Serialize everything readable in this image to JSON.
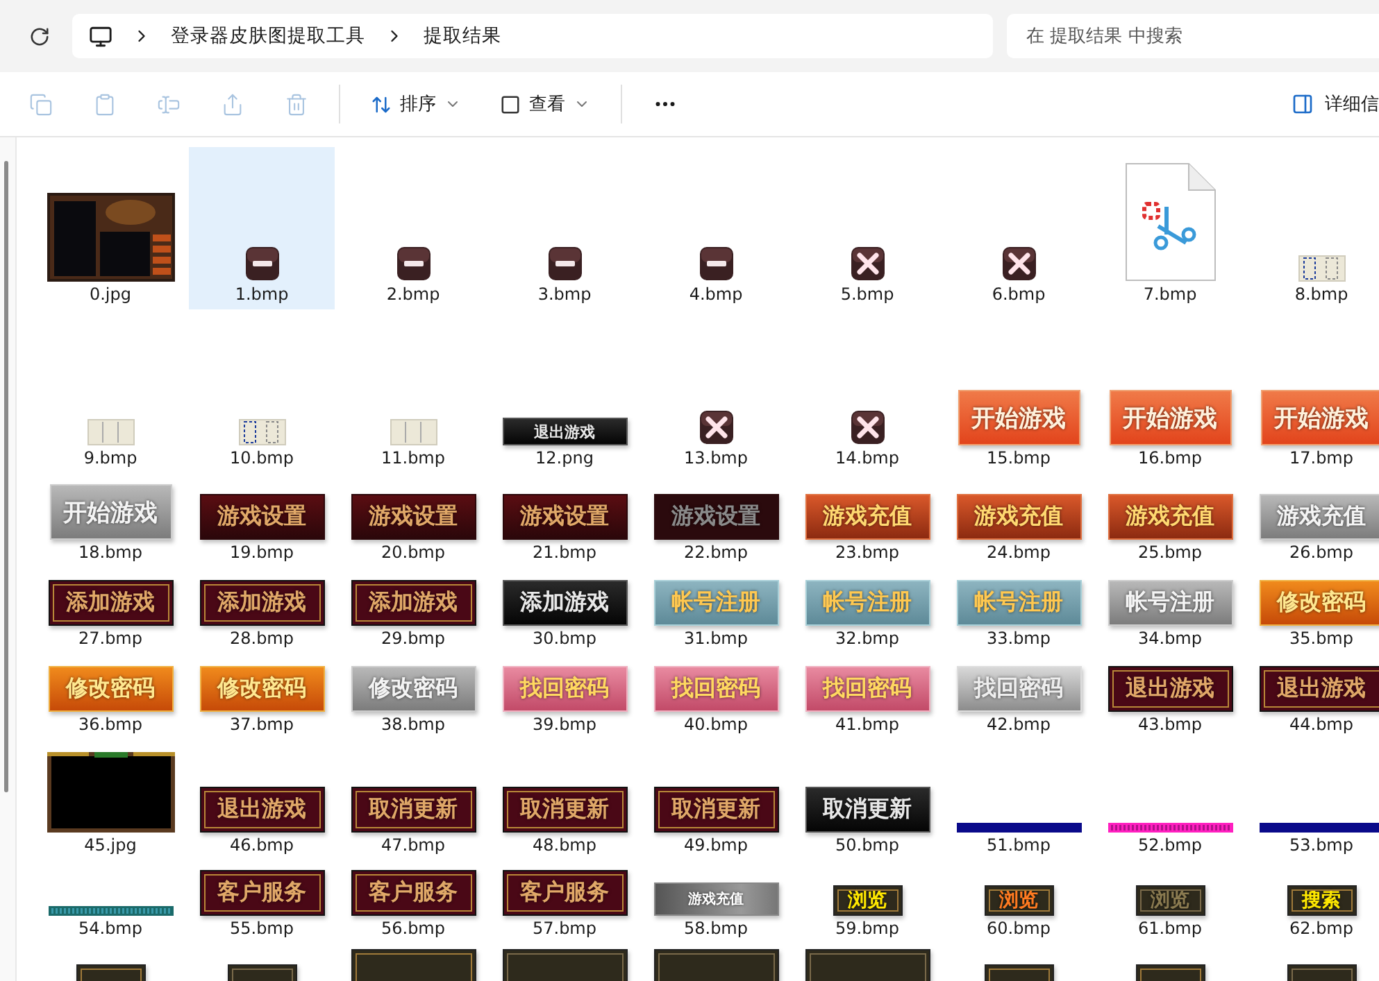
{
  "address": {
    "crumbs": [
      "登录器皮肤图提取工具",
      "提取结果"
    ]
  },
  "search": {
    "placeholder": "在 提取结果 中搜索"
  },
  "toolbar": {
    "icon_buttons": [
      {
        "disabled": true
      },
      {
        "disabled": true
      },
      {
        "disabled": true
      },
      {
        "disabled": true
      },
      {
        "disabled": true
      }
    ],
    "menus": [
      {
        "label": "排序"
      },
      {
        "label": "查看"
      }
    ],
    "details": {
      "label": "详细信"
    }
  },
  "rows": [
    {
      "items": [
        {
          "name": "0.jpg",
          "kind": "picture",
          "selected": false
        },
        {
          "name": "1.bmp",
          "kind": "icon",
          "selected": true
        },
        {
          "name": "2.bmp",
          "kind": "icon",
          "selected": false
        },
        {
          "name": "3.bmp",
          "kind": "icon",
          "selected": false
        },
        {
          "name": "4.bmp",
          "kind": "icon",
          "selected": false
        },
        {
          "name": "5.bmp",
          "kind": "icon",
          "selected": false
        },
        {
          "name": "6.bmp",
          "kind": "icon",
          "selected": false
        },
        {
          "name": "7.bmp",
          "kind": "icon",
          "selected": false
        },
        {
          "name": "8.bmp",
          "kind": "strip",
          "selected": false
        }
      ]
    },
    {
      "items": [
        {
          "name": "9.bmp",
          "kind": "strip",
          "selected": false
        },
        {
          "name": "10.bmp",
          "kind": "strip",
          "selected": false
        },
        {
          "name": "11.bmp",
          "kind": "strip",
          "selected": false
        },
        {
          "name": "12.png",
          "kind": "button",
          "text": "退出游戏",
          "selected": false
        },
        {
          "name": "13.bmp",
          "kind": "icon",
          "selected": false
        },
        {
          "name": "14.bmp",
          "kind": "icon",
          "selected": false
        },
        {
          "name": "15.bmp",
          "kind": "button",
          "text": "开始游戏",
          "selected": false
        },
        {
          "name": "16.bmp",
          "kind": "button",
          "text": "开始游戏",
          "selected": false
        },
        {
          "name": "17.bmp",
          "kind": "button",
          "text": "开始游戏",
          "selected": false
        }
      ]
    },
    {
      "items": [
        {
          "name": "18.bmp",
          "kind": "button",
          "text": "开始游戏",
          "selected": false
        },
        {
          "name": "19.bmp",
          "kind": "button",
          "text": "游戏设置",
          "selected": false
        },
        {
          "name": "20.bmp",
          "kind": "button",
          "text": "游戏设置",
          "selected": false
        },
        {
          "name": "21.bmp",
          "kind": "button",
          "text": "游戏设置",
          "selected": false
        },
        {
          "name": "22.bmp",
          "kind": "button",
          "text": "游戏设置",
          "selected": false
        },
        {
          "name": "23.bmp",
          "kind": "button",
          "text": "游戏充值",
          "selected": false
        },
        {
          "name": "24.bmp",
          "kind": "button",
          "text": "游戏充值",
          "selected": false
        },
        {
          "name": "25.bmp",
          "kind": "button",
          "text": "游戏充值",
          "selected": false
        },
        {
          "name": "26.bmp",
          "kind": "button",
          "text": "游戏充值",
          "selected": false
        }
      ]
    },
    {
      "items": [
        {
          "name": "27.bmp",
          "kind": "button",
          "text": "添加游戏",
          "selected": false
        },
        {
          "name": "28.bmp",
          "kind": "button",
          "text": "添加游戏",
          "selected": false
        },
        {
          "name": "29.bmp",
          "kind": "button",
          "text": "添加游戏",
          "selected": false
        },
        {
          "name": "30.bmp",
          "kind": "button",
          "text": "添加游戏",
          "selected": false
        },
        {
          "name": "31.bmp",
          "kind": "button",
          "text": "帐号注册",
          "selected": false
        },
        {
          "name": "32.bmp",
          "kind": "button",
          "text": "帐号注册",
          "selected": false
        },
        {
          "name": "33.bmp",
          "kind": "button",
          "text": "帐号注册",
          "selected": false
        },
        {
          "name": "34.bmp",
          "kind": "button",
          "text": "帐号注册",
          "selected": false
        },
        {
          "name": "35.bmp",
          "kind": "button",
          "text": "修改密码",
          "selected": false
        }
      ]
    },
    {
      "items": [
        {
          "name": "36.bmp",
          "kind": "button",
          "text": "修改密码",
          "selected": false
        },
        {
          "name": "37.bmp",
          "kind": "button",
          "text": "修改密码",
          "selected": false
        },
        {
          "name": "38.bmp",
          "kind": "button",
          "text": "修改密码",
          "selected": false
        },
        {
          "name": "39.bmp",
          "kind": "button",
          "text": "找回密码",
          "selected": false
        },
        {
          "name": "40.bmp",
          "kind": "button",
          "text": "找回密码",
          "selected": false
        },
        {
          "name": "41.bmp",
          "kind": "button",
          "text": "找回密码",
          "selected": false
        },
        {
          "name": "42.bmp",
          "kind": "button",
          "text": "找回密码",
          "selected": false
        },
        {
          "name": "43.bmp",
          "kind": "button",
          "text": "退出游戏",
          "selected": false
        },
        {
          "name": "44.bmp",
          "kind": "button",
          "text": "退出游戏",
          "selected": false
        }
      ]
    },
    {
      "items": [
        {
          "name": "45.jpg",
          "kind": "picture",
          "selected": false
        },
        {
          "name": "46.bmp",
          "kind": "button",
          "text": "退出游戏",
          "selected": false
        },
        {
          "name": "47.bmp",
          "kind": "button",
          "text": "取消更新",
          "selected": false
        },
        {
          "name": "48.bmp",
          "kind": "button",
          "text": "取消更新",
          "selected": false
        },
        {
          "name": "49.bmp",
          "kind": "button",
          "text": "取消更新",
          "selected": false
        },
        {
          "name": "50.bmp",
          "kind": "button",
          "text": "取消更新",
          "selected": false
        },
        {
          "name": "51.bmp",
          "kind": "line",
          "selected": false
        },
        {
          "name": "52.bmp",
          "kind": "line",
          "selected": false
        },
        {
          "name": "53.bmp",
          "kind": "line",
          "selected": false
        }
      ]
    },
    {
      "items": [
        {
          "name": "54.bmp",
          "kind": "line",
          "selected": false
        },
        {
          "name": "55.bmp",
          "kind": "button",
          "text": "客户服务",
          "selected": false
        },
        {
          "name": "56.bmp",
          "kind": "button",
          "text": "客户服务",
          "selected": false
        },
        {
          "name": "57.bmp",
          "kind": "button",
          "text": "客户服务",
          "selected": false
        },
        {
          "name": "58.bmp",
          "kind": "button",
          "text": "游戏充值",
          "selected": false
        },
        {
          "name": "59.bmp",
          "kind": "button",
          "text": "浏览",
          "selected": false
        },
        {
          "name": "60.bmp",
          "kind": "button",
          "text": "浏览",
          "selected": false
        },
        {
          "name": "61.bmp",
          "kind": "button",
          "text": "浏览",
          "selected": false
        },
        {
          "name": "62.bmp",
          "kind": "button",
          "text": "搜索",
          "selected": false
        }
      ]
    },
    {
      "items": [
        {
          "kind": "button",
          "selected": false
        },
        {
          "kind": "button",
          "selected": false
        },
        {
          "kind": "button",
          "selected": false
        },
        {
          "kind": "button",
          "selected": false
        },
        {
          "kind": "button",
          "selected": false
        },
        {
          "kind": "button",
          "selected": false
        },
        {
          "kind": "button",
          "selected": false
        },
        {
          "kind": "button",
          "selected": false
        },
        {
          "kind": "button",
          "selected": false
        }
      ]
    }
  ]
}
